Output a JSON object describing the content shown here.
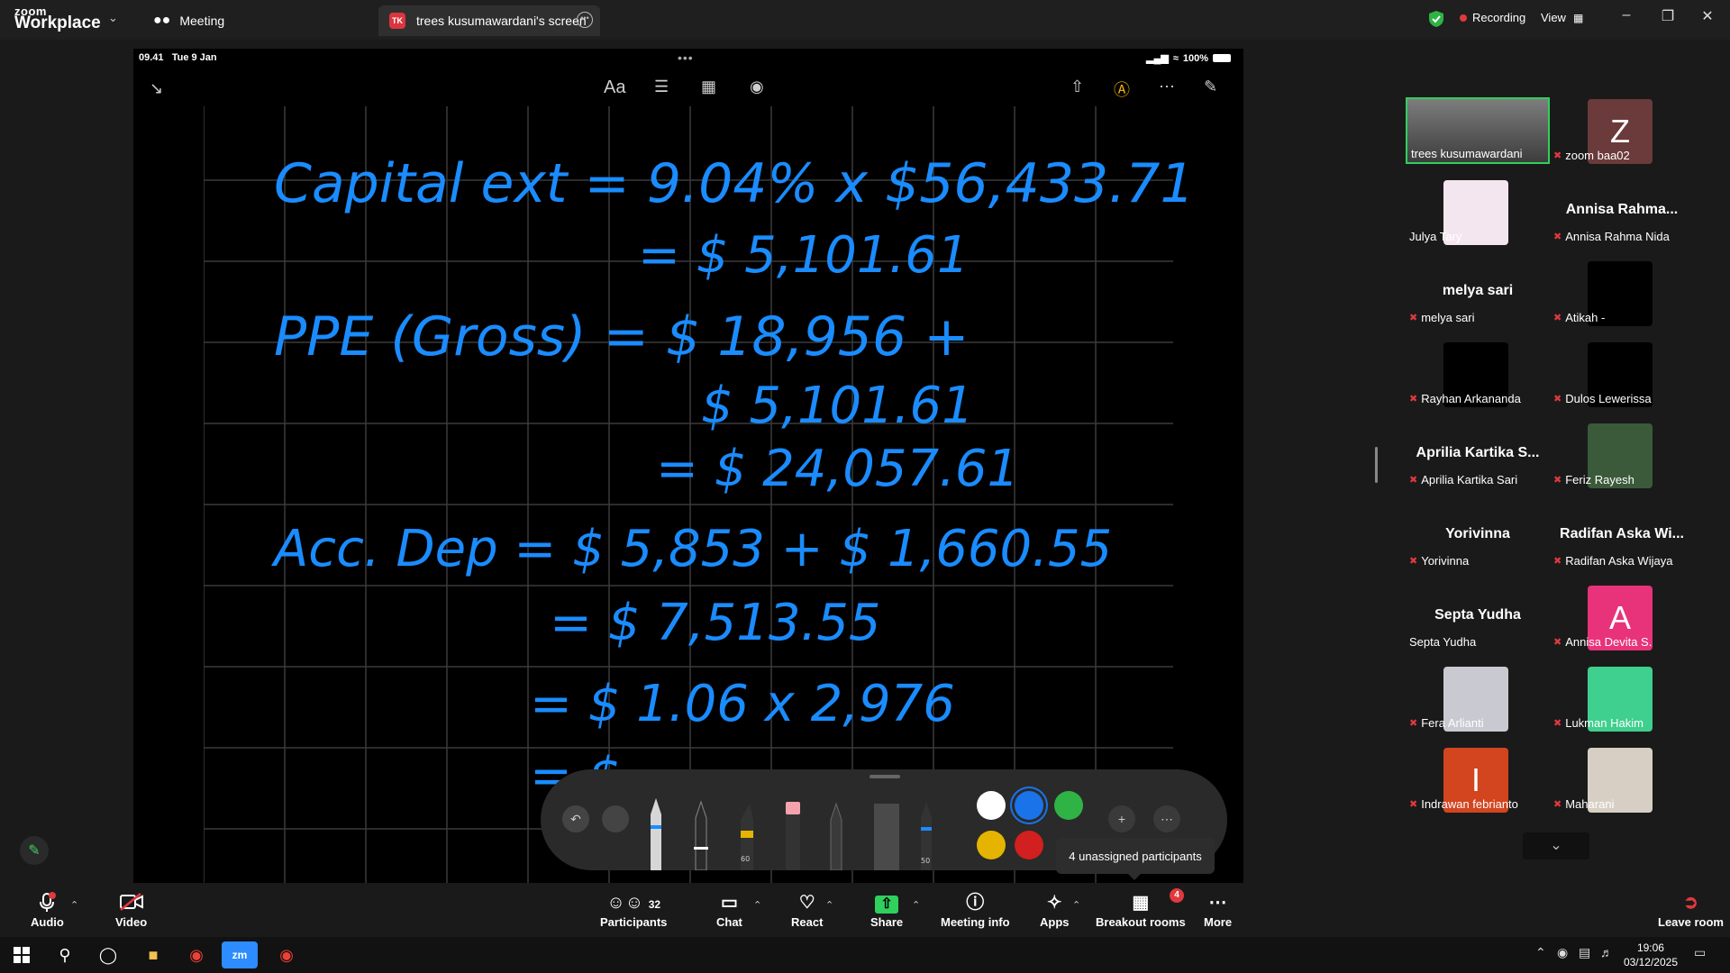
{
  "app": {
    "brand_top": "zoom",
    "brand_bottom": "Workplace"
  },
  "tabs": {
    "meeting": "Meeting",
    "screen_initials": "TK",
    "screen": "trees kusumawardani's screen"
  },
  "status": {
    "recording": "Recording",
    "view": "View"
  },
  "ipad": {
    "time": "09.41",
    "date": "Tue 9 Jan",
    "battery": "100%"
  },
  "notes": {
    "lines": [
      "Capital ext = 9.04% x $56,433.71",
      "= $ 5,101.61",
      "PPE (Gross)  = $ 18,956 +",
      "$ 5,101.61",
      "= $ 24,057.61",
      "Acc. Dep  = $ 5,853 + $ 1,660.55",
      "= $ 7,513.55",
      "= $ 1.06 x 2,976",
      "= $"
    ],
    "ink_color": "#1a8cff"
  },
  "tooltip": "4 unassigned participants",
  "participants": [
    {
      "label": "trees kusumawardani",
      "type": "video",
      "muted": false,
      "active": true
    },
    {
      "label": "zoom baa02",
      "type": "letter",
      "letter": "Z",
      "bg": "#6b3a3a",
      "muted": true
    },
    {
      "label": "Julya Tary",
      "type": "image",
      "bg": "#f3e6ef",
      "muted": false
    },
    {
      "label": "Annisa Rahma Nida",
      "type": "name",
      "big": "Annisa Rahma...",
      "muted": true
    },
    {
      "label": "melya sari",
      "type": "name",
      "big": "melya sari",
      "muted": true
    },
    {
      "label": "Atikah -",
      "type": "dark",
      "muted": true
    },
    {
      "label": "Rayhan Arkananda",
      "type": "dark",
      "muted": true
    },
    {
      "label": "Dulos Lewerissa",
      "type": "dark",
      "muted": true
    },
    {
      "label": "Aprilia Kartika Sari",
      "type": "name",
      "big": "Aprilia Kartika S...",
      "muted": true
    },
    {
      "label": "Feriz Rayesh",
      "type": "image",
      "bg": "#3a5a3a",
      "muted": true
    },
    {
      "label": "Yorivinna",
      "type": "name",
      "big": "Yorivinna",
      "muted": true
    },
    {
      "label": "Radifan Aska Wijaya",
      "type": "name",
      "big": "Radifan Aska Wi...",
      "muted": true
    },
    {
      "label": "Septa Yudha",
      "type": "name",
      "big": "Septa Yudha",
      "muted": false
    },
    {
      "label": "Annisa Devita S.",
      "type": "letter",
      "letter": "A",
      "bg": "#e8337a",
      "muted": true
    },
    {
      "label": "Fera Arlianti",
      "type": "image",
      "bg": "#c9c9d1",
      "muted": true
    },
    {
      "label": "Lukman Hakim",
      "type": "image",
      "bg": "#3fcf8e",
      "muted": true
    },
    {
      "label": "Indrawan febrianto",
      "type": "letter",
      "letter": "I",
      "bg": "#d2451e",
      "muted": true
    },
    {
      "label": "Maharani",
      "type": "image",
      "bg": "#d8cfc4",
      "muted": true
    }
  ],
  "toolbar": {
    "audio": "Audio",
    "video": "Video",
    "participants": "Participants",
    "participants_count": "32",
    "chat": "Chat",
    "react": "React",
    "share": "Share",
    "meeting_info": "Meeting info",
    "apps": "Apps",
    "breakout": "Breakout rooms",
    "breakout_badge": "4",
    "more": "More",
    "leave": "Leave room"
  },
  "taskbar": {
    "time": "19:06",
    "date": "03/12/2025"
  },
  "pen_labels": {
    "highlighter": "60",
    "pen": "50"
  }
}
